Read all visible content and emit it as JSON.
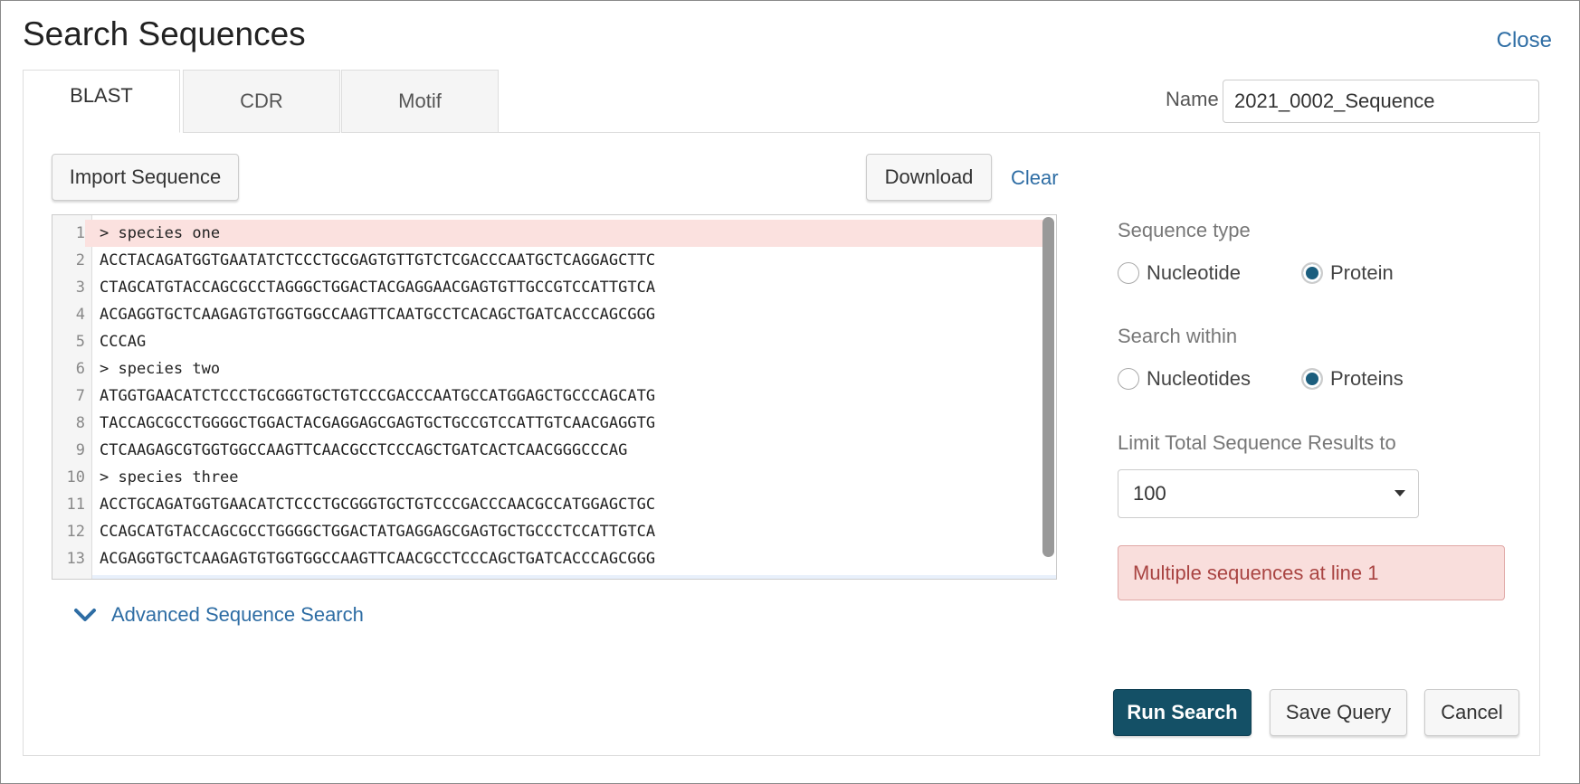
{
  "dialog": {
    "title": "Search Sequences",
    "close_label": "Close"
  },
  "tabs": [
    {
      "label": "BLAST",
      "active": true
    },
    {
      "label": "CDR",
      "active": false
    },
    {
      "label": "Motif",
      "active": false
    }
  ],
  "name_field": {
    "label": "Name",
    "value": "2021_0002_Sequence"
  },
  "toolbar": {
    "import_label": "Import Sequence",
    "download_label": "Download",
    "clear_label": "Clear"
  },
  "editor": {
    "lines": [
      {
        "num": "1",
        "text": "> species one",
        "error": true
      },
      {
        "num": "2",
        "text": "ACCTACAGATGGTGAATATCTCCCTGCGAGTGTTGTCTCGACCCAATGCTCAGGAGCTTC"
      },
      {
        "num": "3",
        "text": "CTAGCATGTACCAGCGCCTAGGGCTGGACTACGAGGAACGAGTGTTGCCGTCCATTGTCA"
      },
      {
        "num": "4",
        "text": "ACGAGGTGCTCAAGAGTGTGGTGGCCAAGTTCAATGCCTCACAGCTGATCACCCAGCGGG"
      },
      {
        "num": "5",
        "text": "CCCAG"
      },
      {
        "num": "6",
        "text": "> species two"
      },
      {
        "num": "7",
        "text": "ATGGTGAACATCTCCCTGCGGGTGCTGTCCCGACCCAATGCCATGGAGCTGCCCAGCATG"
      },
      {
        "num": "8",
        "text": "TACCAGCGCCTGGGGCTGGACTACGAGGAGCGAGTGCTGCCGTCCATTGTCAACGAGGTG"
      },
      {
        "num": "9",
        "text": "CTCAAGAGCGTGGTGGCCAAGTTCAACGCCTCCCAGCTGATCACTCAACGGGCCCAG"
      },
      {
        "num": "10",
        "text": "> species three"
      },
      {
        "num": "11",
        "text": "ACCTGCAGATGGTGAACATCTCCCTGCGGGTGCTGTCCCGACCCAACGCCATGGAGCTGC"
      },
      {
        "num": "12",
        "text": "CCAGCATGTACCAGCGCCTGGGGCTGGACTATGAGGAGCGAGTGCTGCCCTCCATTGTCA"
      },
      {
        "num": "13",
        "text": "ACGAGGTGCTCAAGAGTGTGGTGGCCAAGTTCAACGCCTCCCAGCTGATCACCCAGCGGG"
      }
    ]
  },
  "advanced": {
    "label": "Advanced Sequence Search",
    "icon": "chevron-down-icon"
  },
  "options": {
    "sequence_type": {
      "label": "Sequence type",
      "opt1": "Nucleotide",
      "opt2": "Protein",
      "selected": "Protein"
    },
    "search_within": {
      "label": "Search within",
      "opt1": "Nucleotides",
      "opt2": "Proteins",
      "selected": "Proteins"
    },
    "limit": {
      "label": "Limit Total Sequence Results to",
      "value": "100"
    }
  },
  "error_message": "Multiple sequences at line 1",
  "footer": {
    "run_label": "Run Search",
    "save_label": "Save Query",
    "cancel_label": "Cancel"
  },
  "colors": {
    "primary": "#145066",
    "link": "#2e6da4",
    "error_bg": "#f9dedc",
    "error_text": "#a94442"
  }
}
